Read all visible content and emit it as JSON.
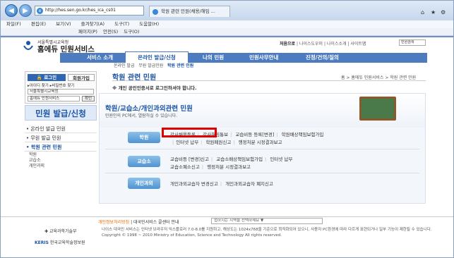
{
  "browser": {
    "url": "http://hes.sen.go.kr/hes_ica_cs01",
    "tab_label": "학원 관련 민원(채용/해임 ...",
    "menu": [
      "파일(F)",
      "편집(E)",
      "보기(V)",
      "즐겨찾기(A)",
      "도구(T)",
      "도움말(H)"
    ],
    "cmd": [
      "페이지(P)",
      "안전(S)",
      "도구(O)"
    ]
  },
  "site": {
    "org": "서울특별시교육청",
    "name": "홈에듀 민원서비스",
    "util": [
      "처음으로",
      "나이스도우미",
      "나이스소개",
      "사이트맵"
    ],
    "search_placeholder": "민원검색",
    "gnb": [
      "서비스 소개",
      "온라인 발급/신청",
      "나의 민원",
      "민원사무안내",
      "진정/건의/질의"
    ],
    "subnav": [
      "온라인 발급",
      "무원 발급민원",
      "학원 관련 민원"
    ]
  },
  "left": {
    "login": "로그인",
    "join": "회원가입",
    "find_id": "아이디 찾기",
    "find_pw": "비밀번호 찾기",
    "office": "서울특별시교육청",
    "office2": "홈에듀 민원서비스",
    "confirm": "확인",
    "menu_title": "민원 발급/신청",
    "menu": [
      "온라인 발급 민원",
      "무원 발급 민원",
      "학원 관련 민원"
    ],
    "sub": [
      "학원",
      "교습소",
      "개인과외"
    ]
  },
  "main": {
    "title": "학원 관련 민원",
    "breadcrumb": "홈 > 홈에듀 민원서비스 > 학원 관련 민원",
    "notice": "※ 개인 공인인증서로 로그인하셔야 합니다.",
    "panel_title": "학원/교습소/개인과외관련 민원",
    "panel_sub": "민원인의 PC에서, 열람하실 수 있습니다.",
    "categories": [
      {
        "label": "학원",
        "rows": [
          [
            "강사채용등록",
            "강사해임통보",
            "교습비등 등록[변경]",
            "학원배상책임보험가입"
          ],
          [
            "인터넷 납부",
            "학원폐원신고",
            "행정처분 시정결과보고"
          ]
        ]
      },
      {
        "label": "교습소",
        "rows": [
          [
            "교습비등 [변경]신고",
            "교습소배상책임보험가입",
            "인터넷 납부"
          ],
          [
            "교습소폐소신고",
            "행정처분 시정결과보고"
          ]
        ]
      },
      {
        "label": "개인과외",
        "rows": [
          [
            "개인과외교습자 변경신고",
            "개인과외교습자 폐지신고"
          ]
        ]
      }
    ]
  },
  "footer": {
    "privacy": "개인정보처리방침",
    "other": "대국민서비스 콜센터 안내",
    "select": "접하시는 지역을 선택하세요",
    "info": "나이스 대국민 서비스는 인터넷 브라우저 익스플로러 7.0-8.0를 지원하고, 해상도는 1024x768을 기준으로 최적화되어 있으니, 사용자 PC환경에 따라 다르게 표현되거나 일부 기능이 제한될 수 있습니다.",
    "copyright": "Copyright © 1998 ~ 2010 Ministry of Education, Science and Technology All rights reserved.",
    "logo1": "교육과학기술부",
    "logo2": "한국교육학술정보원"
  }
}
